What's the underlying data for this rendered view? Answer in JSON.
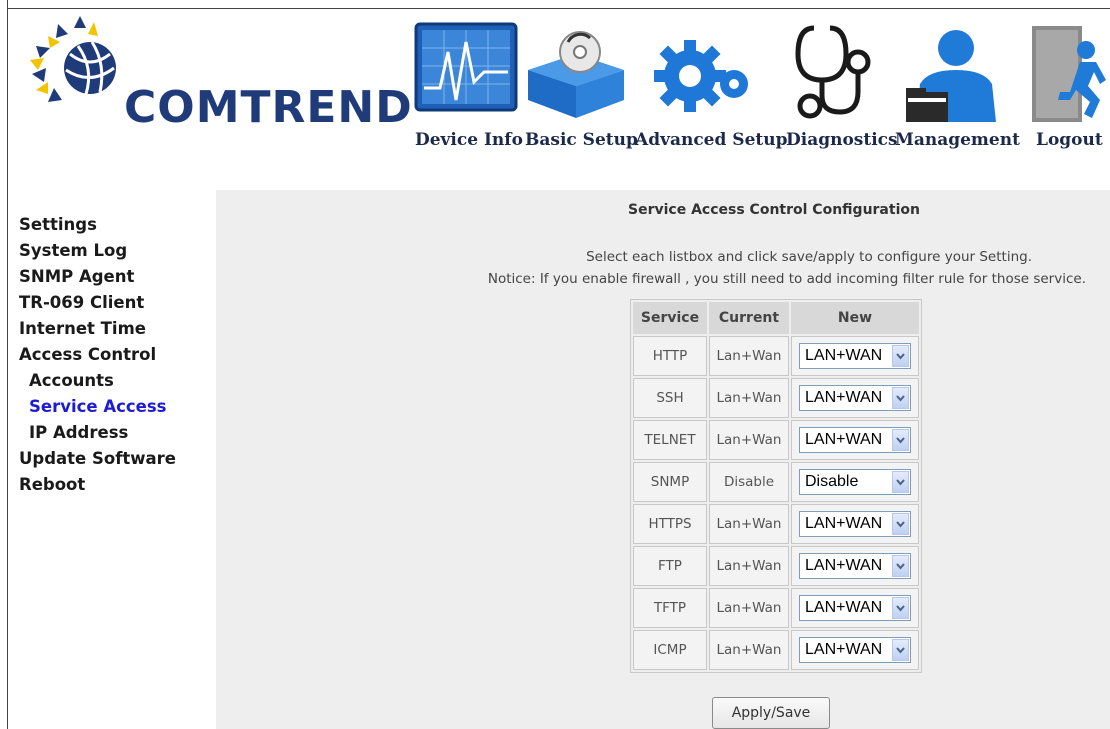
{
  "brand": {
    "name": "COMTREND"
  },
  "nav": [
    {
      "label": "Device Info",
      "icon": "chart-monitor-icon"
    },
    {
      "label": "Basic Setup",
      "icon": "disc-box-icon"
    },
    {
      "label": "Advanced Setup",
      "icon": "gears-icon"
    },
    {
      "label": "Diagnostics",
      "icon": "stethoscope-icon"
    },
    {
      "label": "Management",
      "icon": "user-folder-icon"
    },
    {
      "label": "Logout",
      "icon": "exit-door-icon"
    }
  ],
  "sidebar": {
    "items": [
      {
        "label": "Settings"
      },
      {
        "label": "System Log"
      },
      {
        "label": "SNMP Agent"
      },
      {
        "label": "TR-069 Client"
      },
      {
        "label": "Internet Time"
      },
      {
        "label": "Access Control"
      },
      {
        "label": "Accounts"
      },
      {
        "label": "Service Access",
        "active": true
      },
      {
        "label": "IP Address"
      },
      {
        "label": "Update Software"
      },
      {
        "label": "Reboot"
      }
    ]
  },
  "main": {
    "title": "Service Access Control Configuration",
    "desc_line1": "Select each listbox and click save/apply to configure your Setting.",
    "desc_line2": "Notice: If you enable firewall , you still need to add incoming filter rule for those service.",
    "table": {
      "headers": {
        "service": "Service",
        "current": "Current",
        "new": "New"
      },
      "rows": [
        {
          "service": "HTTP",
          "current": "Lan+Wan",
          "new": "LAN+WAN"
        },
        {
          "service": "SSH",
          "current": "Lan+Wan",
          "new": "LAN+WAN"
        },
        {
          "service": "TELNET",
          "current": "Lan+Wan",
          "new": "LAN+WAN"
        },
        {
          "service": "SNMP",
          "current": "Disable",
          "new": "Disable"
        },
        {
          "service": "HTTPS",
          "current": "Lan+Wan",
          "new": "LAN+WAN"
        },
        {
          "service": "FTP",
          "current": "Lan+Wan",
          "new": "LAN+WAN"
        },
        {
          "service": "TFTP",
          "current": "Lan+Wan",
          "new": "LAN+WAN"
        },
        {
          "service": "ICMP",
          "current": "Lan+Wan",
          "new": "LAN+WAN"
        }
      ]
    },
    "apply_label": "Apply/Save"
  },
  "colors": {
    "brand": "#1f3b7a",
    "active_link": "#1c1cd6",
    "content_bg": "#eeeeee"
  }
}
